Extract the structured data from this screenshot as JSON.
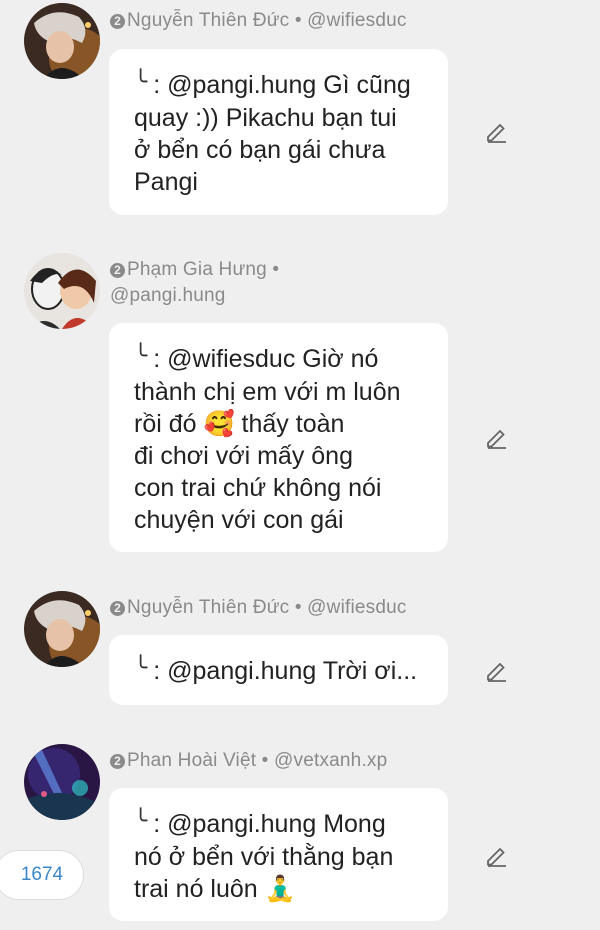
{
  "comments": [
    {
      "avatar_icon": "avatar-dark-hair-boy",
      "meta_line1": "Nguyễn Thiên Đức • @wifiesduc",
      "meta_line2": "",
      "rank": "2",
      "reply_glyph": "╰",
      "lines": ": @pangi.hung Gì cũng quay :)) Pikachu bạn tui ở bển có bạn gái chưa Pangi",
      "line_breaks": [
        ": @pangi.hung Gì cũng",
        "quay :)) Pikachu bạn tui",
        "ở bển có bạn gái chưa",
        "Pangi"
      ]
    },
    {
      "avatar_icon": "avatar-anime-pair",
      "meta_line1": "Phạm Gia Hưng •",
      "meta_line2": "@pangi.hung",
      "rank": "2",
      "reply_glyph": "╰",
      "line_breaks": [
        ": @wifiesduc Giờ nó",
        "thành chị em với m luôn",
        "rồi đó 🥰 thấy toàn",
        "đi chơi với mấy ông",
        "con trai chứ không nói",
        "chuyện với con gái"
      ]
    },
    {
      "avatar_icon": "avatar-dark-hair-boy",
      "meta_line1": "Nguyễn Thiên Đức • @wifiesduc",
      "meta_line2": "",
      "rank": "2",
      "reply_glyph": "╰",
      "line_breaks": [
        ": @pangi.hung Trời ơi..."
      ]
    },
    {
      "avatar_icon": "avatar-purple-night",
      "meta_line1": "Phan Hoài Việt • @vetxanh.xp",
      "meta_line2": "",
      "rank": "2",
      "reply_glyph": "╰",
      "line_breaks": [
        ": @pangi.hung Mong",
        "nó ở bển với thằng bạn",
        "trai nó luôn 🧘‍♂️"
      ]
    }
  ],
  "count_badge": "1674",
  "edit_icon": "pencil-icon",
  "colors": {
    "background": "#efefef",
    "bubble": "#ffffff",
    "meta_text": "#8a8a8a",
    "count_text": "#3b87c9"
  }
}
